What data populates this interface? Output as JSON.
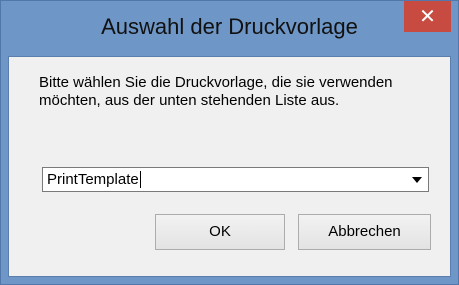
{
  "window": {
    "title": "Auswahl der Druckvorlage",
    "close_label": "✕"
  },
  "dialog": {
    "message": "Bitte wählen Sie die Druckvorlage, die sie verwenden möchten, aus der unten stehenden Liste aus.",
    "template_select": {
      "selected_value": "PrintTemplate"
    },
    "ok_label": "OK",
    "cancel_label": "Abbrechen"
  },
  "colors": {
    "titlebar": "#6e96c6",
    "close_button": "#c74b40",
    "client_background": "#f0f0f0"
  }
}
